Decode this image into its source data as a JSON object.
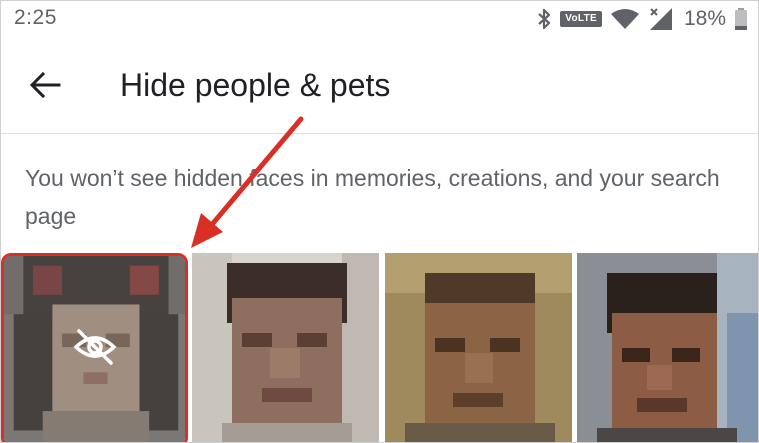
{
  "status_bar": {
    "time": "2:25",
    "network_badge": "VoLTE",
    "battery_percent": "18%",
    "icons": [
      "bluetooth-icon",
      "volte-icon",
      "wifi-icon",
      "cellular-signal-icon",
      "battery-icon"
    ]
  },
  "app_bar": {
    "back_icon": "arrow-back-icon",
    "title": "Hide people & pets"
  },
  "description": "You won’t see hidden faces in memories, creations, and your search page",
  "faces": [
    {
      "id": "face-1",
      "hidden": true
    },
    {
      "id": "face-2",
      "hidden": false
    },
    {
      "id": "face-3",
      "hidden": false
    },
    {
      "id": "face-4",
      "hidden": false
    }
  ],
  "colors": {
    "accent_red": "#d93025",
    "text_primary": "#202124",
    "text_secondary": "#5f6368"
  }
}
